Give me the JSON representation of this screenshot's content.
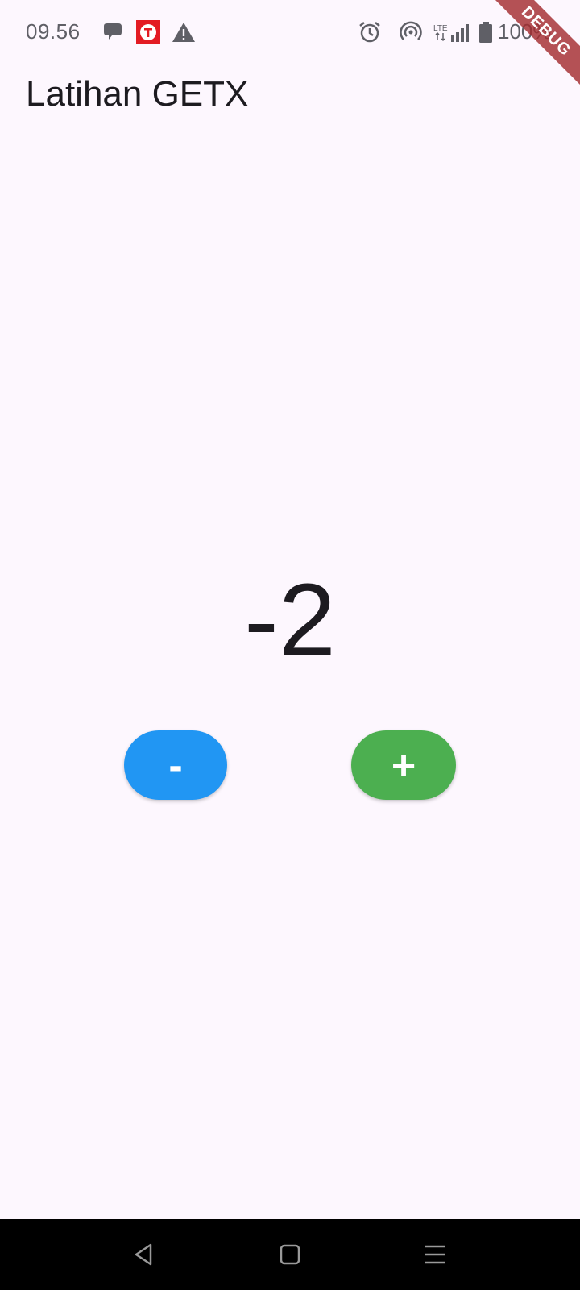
{
  "status_bar": {
    "time": "09.56",
    "battery_text": "100%",
    "icons": [
      "chat-bubble-icon",
      "app-t-icon",
      "warning-icon",
      "alarm-icon",
      "hotspot-icon",
      "lte-icon",
      "signal-icon",
      "battery-icon"
    ]
  },
  "debug_banner": {
    "label": "DEBUG"
  },
  "app_bar": {
    "title": "Latihan GETX"
  },
  "counter": {
    "value": "-2"
  },
  "buttons": {
    "decrement_label": "-",
    "increment_label": "+"
  },
  "colors": {
    "background": "#fdf7fe",
    "decrement": "#2196f3",
    "increment": "#4caf50",
    "debug_ribbon": "#a32c30"
  },
  "nav_bar": {
    "icons": [
      "back-icon",
      "home-icon",
      "menu-icon"
    ]
  }
}
